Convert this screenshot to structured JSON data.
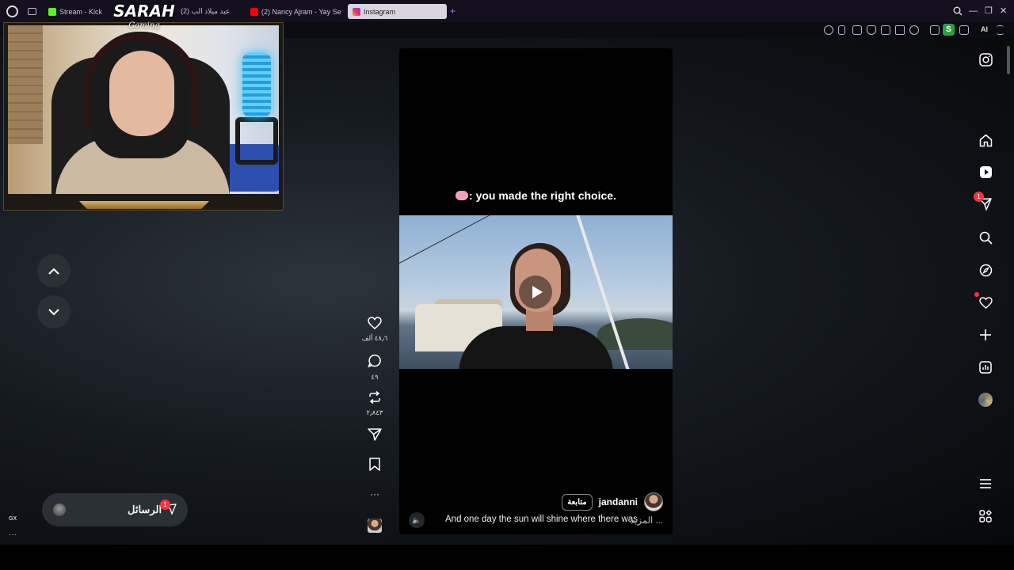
{
  "browser": {
    "tabs": [
      {
        "label": "Stream - Kick",
        "favicon_color": "#53fc18",
        "active": false
      },
      {
        "label": "(2) عيد ميلاد الب",
        "favicon_color": "#5a5a6a",
        "active": false
      },
      {
        "label": "(2) Nancy Ajram - Yay Se",
        "favicon_color": "#ff0000",
        "active": false
      },
      {
        "label": "Instagram",
        "favicon_color": "#e1306c",
        "active": true
      }
    ],
    "new_tab": "+",
    "window_controls": [
      "—",
      "❐",
      "✕"
    ],
    "extension_badge": "S",
    "ai_label": "AI"
  },
  "overlay": {
    "logo": "SARAH",
    "logo_sub": "Gaming"
  },
  "reel": {
    "caption_top": ": you made the right choice.",
    "username": "jandanni",
    "follow_label": "متابعة",
    "description": "And one day the sun will shine where there was",
    "more_label": "... المزيد",
    "mute_icon": "🔈"
  },
  "actions": {
    "likes": "٤٨٫٦ ألف",
    "comments": "٤٩",
    "reposts": "٢٫٨٤٣",
    "more": "···"
  },
  "messages": {
    "label": "الرسائل",
    "badge": "1"
  },
  "sidebar": {
    "notifications_badge": "1"
  },
  "gx": {
    "label": "GX",
    "more": "···"
  },
  "colors": {
    "accent_red": "#ff3040",
    "page_bg": "#151a20",
    "pill_bg": "#2b3036"
  }
}
